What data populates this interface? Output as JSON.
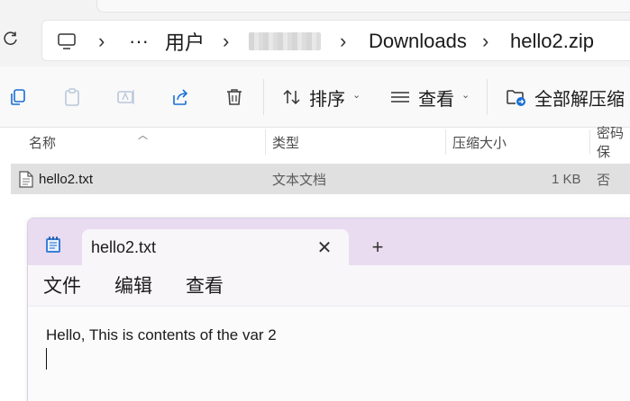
{
  "explorer": {
    "breadcrumb": {
      "more": "···",
      "users": "用户",
      "downloads": "Downloads",
      "zip": "hello2.zip",
      "separator": "›"
    },
    "toolbar": {
      "sort_label": "排序",
      "view_label": "查看",
      "extract_all_label": "全部解压缩"
    },
    "columns": {
      "name": "名称",
      "type": "类型",
      "compressed_size": "压缩大小",
      "password": "密码保"
    },
    "files": [
      {
        "name": "hello2.txt",
        "type": "文本文档",
        "size": "1 KB",
        "password": "否"
      }
    ],
    "accent_color": "#1a6fd3"
  },
  "notepad": {
    "tab_title": "hello2.txt",
    "menu": {
      "file": "文件",
      "edit": "编辑",
      "view": "查看"
    },
    "content": "Hello, This is contents of the var 2",
    "titlebar_color": "#e9dcf0"
  }
}
